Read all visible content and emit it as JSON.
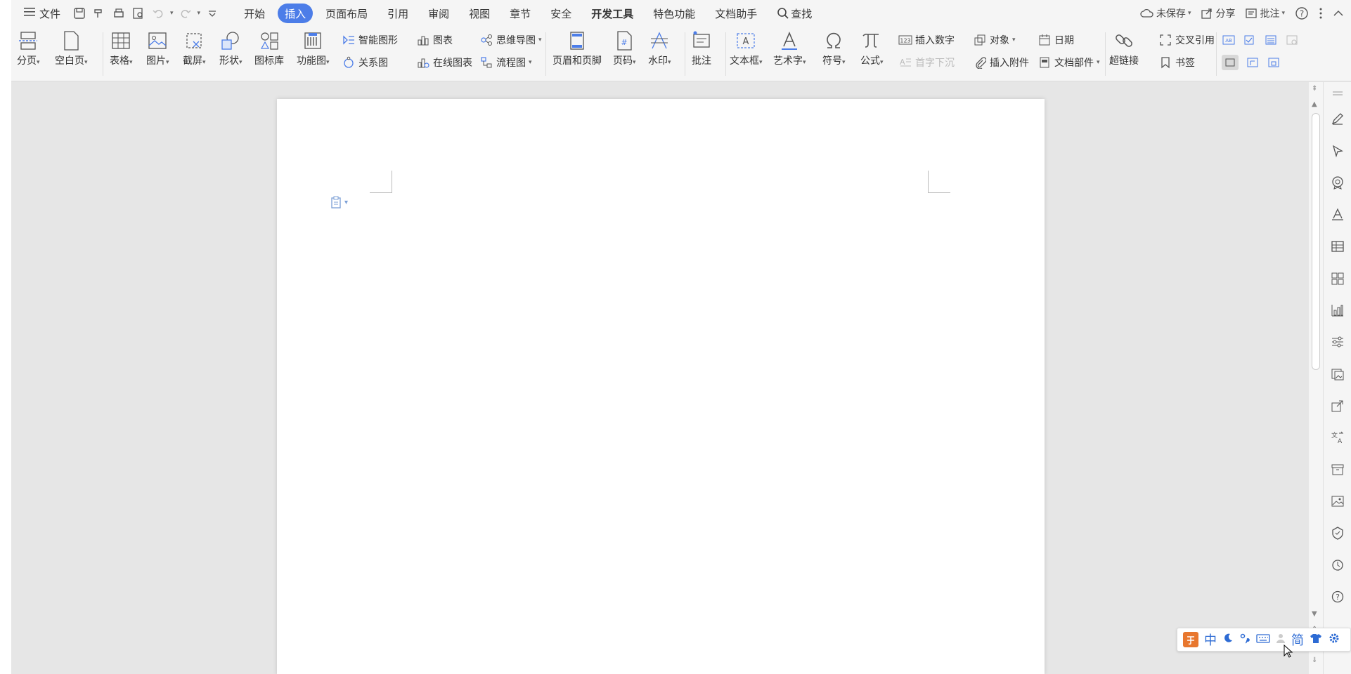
{
  "menubar": {
    "file_label": "文件",
    "tabs": [
      "开始",
      "插入",
      "页面布局",
      "引用",
      "审阅",
      "视图",
      "章节",
      "安全",
      "开发工具",
      "特色功能",
      "文档助手"
    ],
    "active_tab": "插入",
    "search_label": "查找",
    "unsaved_label": "未保存",
    "share_label": "分享",
    "comment_label": "批注"
  },
  "ribbon": {
    "page_break": "分页",
    "blank_page": "空白页",
    "table": "表格",
    "picture": "图片",
    "screenshot": "截屏",
    "shape": "形状",
    "icon_library": "图标库",
    "function_chart": "功能图",
    "smart_art": "智能图形",
    "chart": "图表",
    "mind_map": "思维导图",
    "relation_chart": "关系图",
    "online_chart": "在线图表",
    "flow_chart": "流程图",
    "header_footer": "页眉和页脚",
    "page_number": "页码",
    "watermark": "水印",
    "comment": "批注",
    "text_box": "文本框",
    "word_art": "艺术字",
    "symbol": "符号",
    "formula": "公式",
    "insert_number": "插入数字",
    "object": "对象",
    "date": "日期",
    "drop_cap": "首字下沉",
    "attachment": "插入附件",
    "doc_parts": "文档部件",
    "hyperlink": "超链接",
    "cross_ref": "交叉引用",
    "bookmark": "书签"
  },
  "ime": {
    "chinese": "中",
    "simplified": "简"
  },
  "colors": {
    "accent": "#4c7de8",
    "ime_blue": "#2d6bd4",
    "ime_logo": "#e8772e"
  }
}
